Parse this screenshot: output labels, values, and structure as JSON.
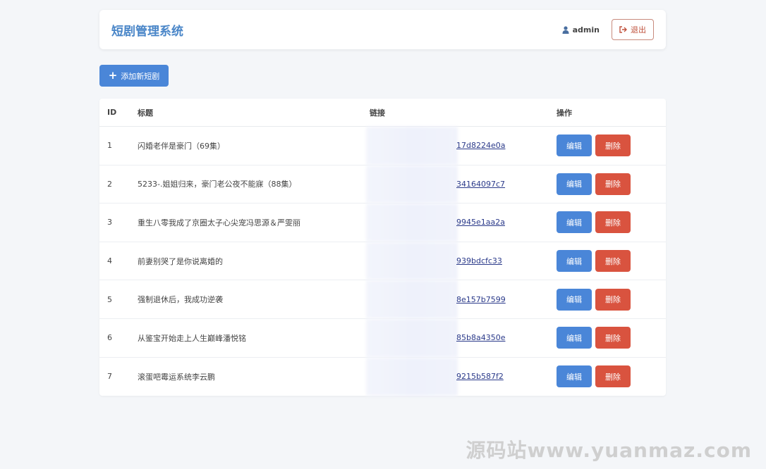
{
  "header": {
    "app_title": "短剧管理系统",
    "username": "admin",
    "logout_label": "退出"
  },
  "toolbar": {
    "add_label": "添加新短剧"
  },
  "table": {
    "columns": {
      "id": "ID",
      "title": "标题",
      "link": "链接",
      "ops": "操作"
    },
    "edit_label": "编辑",
    "delete_label": "删除",
    "rows": [
      {
        "id": "1",
        "title": "闪婚老伴是豪门（69集）",
        "link": "17d8224e0a"
      },
      {
        "id": "2",
        "title": "5233-.姐姐归来，豪门老公夜不能寐（88集）",
        "link": "34164097c7"
      },
      {
        "id": "3",
        "title": "重生八零我成了京圈太子心尖宠冯思源＆严雯丽",
        "link": "9945e1aa2a"
      },
      {
        "id": "4",
        "title": "前妻别哭了是你说离婚的",
        "link": "939bdcfc33"
      },
      {
        "id": "5",
        "title": "强制退休后，我成功逆袭",
        "link": "8e157b7599"
      },
      {
        "id": "6",
        "title": "从鉴宝开始走上人生巅峰潘悦铭",
        "link": "85b8a4350e"
      },
      {
        "id": "7",
        "title": "滚蛋吧霉运系统李云鹏",
        "link": "9215b587f2"
      }
    ]
  },
  "watermark": "源码站www.yuanmaz.com"
}
